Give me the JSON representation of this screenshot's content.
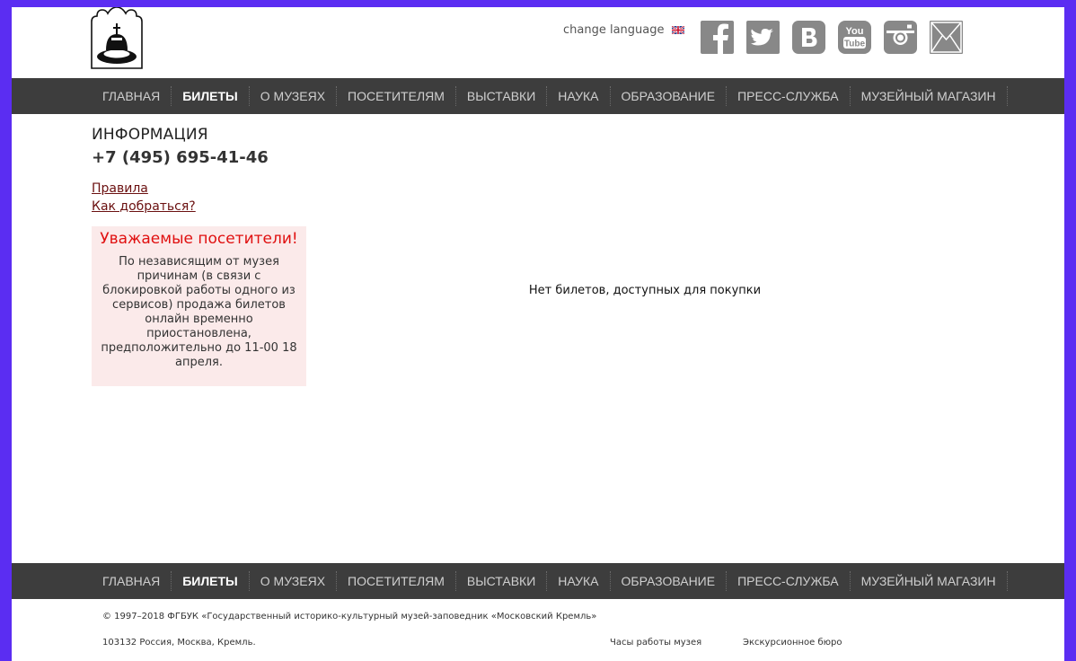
{
  "header": {
    "change_language": "change language",
    "social_icons": [
      "facebook-icon",
      "twitter-icon",
      "vk-icon",
      "youtube-icon",
      "instagram-icon",
      "mail-icon"
    ],
    "youtube_text": [
      "You",
      "Tube"
    ]
  },
  "nav": {
    "items": [
      {
        "label": "ГЛАВНАЯ"
      },
      {
        "label": "БИЛЕТЫ"
      },
      {
        "label": "О МУЗЕЯХ"
      },
      {
        "label": "ПОСЕТИТЕЛЯМ"
      },
      {
        "label": "ВЫСТАВКИ"
      },
      {
        "label": "НАУКА"
      },
      {
        "label": "ОБРАЗОВАНИЕ"
      },
      {
        "label": "ПРЕСС-СЛУЖБА"
      },
      {
        "label": "МУЗЕЙНЫЙ МАГАЗИН"
      }
    ],
    "active_index": 1
  },
  "sidebar": {
    "info_title": "ИНФОРМАЦИЯ",
    "phone": "+7 (495) 695-41-46",
    "links": [
      {
        "label": "Правила "
      },
      {
        "label": "Как добраться?"
      }
    ],
    "notice": {
      "title": "Уважаемые посетители!",
      "text": "По независящим от музея причинам (в связи с блокировкой работы одного из сервисов) продажа билетов онлайн временно приостановлена, предположительно до 11-00 18 апреля."
    }
  },
  "main": {
    "message": "Нет билетов, доступных для покупки"
  },
  "footer": {
    "copyright": "© 1997–2018 ФГБУК «Государственный историко-культурный музей-заповедник «Московский Кремль»",
    "address": "103132 Россия, Москва, Кремль.",
    "hours_link": "Часы работы музея",
    "excursion_link": "Экскурсионное бюро"
  },
  "colors": {
    "outer_border": "#5b2df2",
    "nav_background": "#3d3d3d",
    "social_gray": "#888888",
    "notice_background": "#fbeaea",
    "notice_title": "#e01010",
    "link_color": "#6b1010"
  }
}
